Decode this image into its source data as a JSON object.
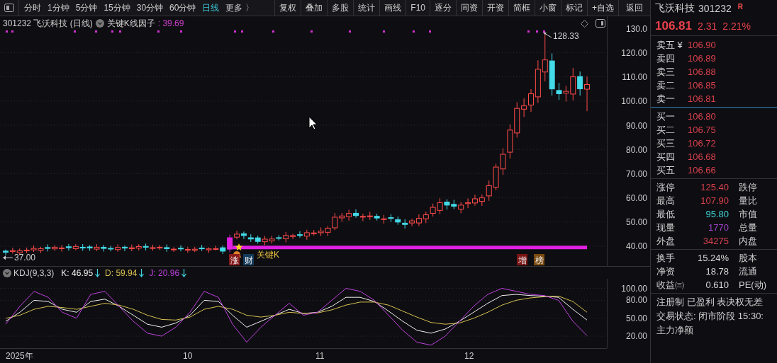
{
  "toolbar": {
    "periods": [
      {
        "label": "分时",
        "selected": false
      },
      {
        "label": "1分钟",
        "selected": false
      },
      {
        "label": "5分钟",
        "selected": false
      },
      {
        "label": "15分钟",
        "selected": false
      },
      {
        "label": "30分钟",
        "selected": false
      },
      {
        "label": "60分钟",
        "selected": false
      },
      {
        "label": "日线",
        "selected": true
      },
      {
        "label": "更多 〉",
        "selected": false
      }
    ],
    "buttons": [
      "复权",
      "叠加",
      "多股",
      "统计",
      "画线",
      "F10",
      "逐分",
      "同资",
      "开资",
      "简框",
      "小窗",
      "标记",
      "+自选",
      "返回"
    ]
  },
  "chart_header": {
    "symbol": "301232 飞沃科技 (日线)",
    "indicator": "关键K线因子",
    "value": ": 39.69"
  },
  "price_axis": [
    "130.0",
    "120.00",
    "110.00",
    "100.00",
    "90.00",
    "80.00",
    "70.00",
    "60.00",
    "50.00",
    "40.00"
  ],
  "annotations": {
    "high": "128.33",
    "low": "37.00",
    "key_k": "关键K"
  },
  "signals": [
    {
      "label": "涨",
      "color": "#8a1c1c"
    },
    {
      "label": "财",
      "color": "#123a5a"
    },
    {
      "label": "增",
      "color": "#7a1414"
    },
    {
      "label": "榜",
      "color": "#7a4a10"
    }
  ],
  "kdj": {
    "title": "KDJ(9,3,3)",
    "readings": [
      ": 46.95",
      ": 59.94",
      ": 20.96"
    ],
    "chart_data": {
      "type": "line",
      "ylim": [
        0,
        116
      ],
      "grid": true,
      "yticks": [
        {
          "value": 100,
          "label": "100.00"
        },
        {
          "value": 80,
          "label": "80.00"
        },
        {
          "value": 50,
          "label": "50.00"
        },
        {
          "value": 20,
          "label": "20.00"
        }
      ],
      "series": [
        {
          "name": "K",
          "color": "#f0f0f0",
          "values": [
            45,
            60,
            80,
            78,
            65,
            60,
            78,
            82,
            70,
            55,
            40,
            35,
            42,
            55,
            80,
            78,
            55,
            35,
            45,
            55,
            65,
            58,
            60,
            70,
            85,
            85,
            78,
            62,
            45,
            30,
            25,
            32,
            45,
            60,
            75,
            88,
            90,
            88,
            87,
            85,
            65,
            47
          ]
        },
        {
          "name": "D",
          "color": "#d8c050",
          "values": [
            50,
            55,
            65,
            70,
            68,
            65,
            70,
            75,
            72,
            65,
            55,
            48,
            47,
            52,
            65,
            70,
            65,
            55,
            52,
            55,
            60,
            58,
            59,
            64,
            72,
            77,
            77,
            72,
            62,
            52,
            43,
            40,
            42,
            50,
            60,
            72,
            80,
            84,
            86,
            87,
            78,
            60
          ]
        },
        {
          "name": "J",
          "color": "#c040e0",
          "values": [
            40,
            70,
            95,
            85,
            60,
            50,
            90,
            95,
            70,
            45,
            25,
            20,
            35,
            60,
            95,
            85,
            40,
            10,
            35,
            55,
            75,
            55,
            60,
            80,
            100,
            95,
            80,
            55,
            30,
            10,
            5,
            20,
            45,
            70,
            90,
            100,
            95,
            90,
            88,
            80,
            45,
            21
          ]
        }
      ]
    }
  },
  "time_axis": [
    "2025年",
    "10",
    "11",
    "12"
  ],
  "quote": {
    "name": "飞沃科技",
    "code": "301232",
    "badge": "R",
    "price": "106.81",
    "change": "2.31",
    "change_pct": "2.21%"
  },
  "asks": [
    {
      "label": "卖五 ¥",
      "price": "106.90"
    },
    {
      "label": "卖四",
      "price": "106.89"
    },
    {
      "label": "卖三",
      "price": "106.88"
    },
    {
      "label": "卖二",
      "price": "106.85"
    },
    {
      "label": "卖一",
      "price": "106.81"
    }
  ],
  "bids": [
    {
      "label": "买一",
      "price": "106.80"
    },
    {
      "label": "买二",
      "price": "106.75"
    },
    {
      "label": "买三",
      "price": "106.72"
    },
    {
      "label": "买四",
      "price": "106.68"
    },
    {
      "label": "买五",
      "price": "106.66"
    }
  ],
  "stats": [
    {
      "label": "涨停",
      "value": "125.40",
      "color": "#d8404c",
      "label2": "跌停"
    },
    {
      "label": "最高",
      "value": "107.90",
      "color": "#d8404c",
      "label2": "量比"
    },
    {
      "label": "最低",
      "value": "95.80",
      "color": "#3fd4d4",
      "label2": "市值"
    },
    {
      "label": "现量",
      "value": "1770",
      "color": "#a040c8",
      "label2": "总量"
    },
    {
      "label": "外盘",
      "value": "34275",
      "color": "#d8404c",
      "label2": "内盘"
    }
  ],
  "fundamentals": [
    {
      "label": "换手",
      "value": "15.24%",
      "label2": "股本"
    },
    {
      "label": "净资",
      "value": "18.78",
      "label2": "流通"
    },
    {
      "label": "收益㈢",
      "value": "0.610",
      "label2": "PE(动)"
    }
  ],
  "notes": [
    "注册制 已盈利 表决权无差",
    "交易状态: 闭市阶段 15:30:"
  ],
  "flow_label": "主力净额"
}
